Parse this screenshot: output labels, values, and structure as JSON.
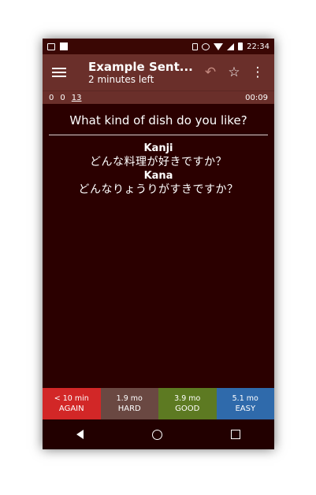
{
  "status_bar": {
    "time": "22:34",
    "icons": [
      "image-icon",
      "cast-icon",
      "vibrate-icon",
      "alarm-icon",
      "wifi-icon",
      "signal-icon",
      "battery-icon"
    ]
  },
  "toolbar": {
    "title": "Example Sent...",
    "subtitle": "2 minutes left",
    "icons": [
      "menu-icon",
      "undo-icon",
      "star-icon",
      "more-vert-icon"
    ]
  },
  "counts": {
    "new": "0",
    "learning": "0",
    "review": "13",
    "timer": "00:09"
  },
  "card": {
    "question": "What kind of dish do you like?",
    "fields": [
      {
        "label": "Kanji",
        "value": "どんな料理が好きですか？"
      },
      {
        "label": "Kana",
        "value": "どんなりょうりがすきですか？"
      }
    ]
  },
  "answer_buttons": [
    {
      "time": "< 10 min",
      "label": "AGAIN",
      "color": "#d22727"
    },
    {
      "time": "1.9 mo",
      "label": "HARD",
      "color": "#6a4842"
    },
    {
      "time": "3.9 mo",
      "label": "GOOD",
      "color": "#5d7a22"
    },
    {
      "time": "5.1 mo",
      "label": "EASY",
      "color": "#2f6aab"
    }
  ],
  "colors": {
    "toolbar": "#6a2f2a",
    "card_background": "#2b0000"
  }
}
